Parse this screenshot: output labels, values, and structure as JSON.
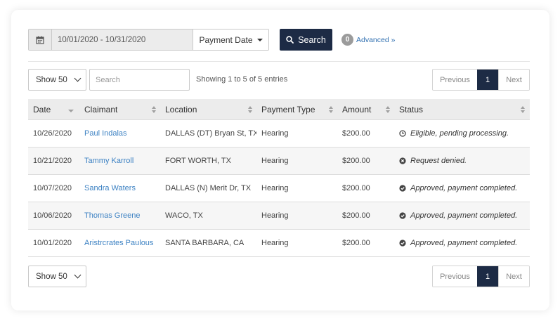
{
  "filter": {
    "calendar_icon": "calendar-icon",
    "date_range": "10/01/2020 - 10/31/2020",
    "date_type_label": "Payment Date",
    "search_label": "Search",
    "advanced_count": "0",
    "advanced_label": "Advanced »"
  },
  "controls": {
    "page_size": "Show 50",
    "search_placeholder": "Search",
    "info": "Showing 1 to 5 of 5 entries",
    "pager": {
      "previous": "Previous",
      "current": "1",
      "next": "Next"
    }
  },
  "table": {
    "columns": [
      "Date",
      "Claimant",
      "Location",
      "Payment Type",
      "Amount",
      "Status"
    ],
    "rows": [
      {
        "date": "10/26/2020",
        "claimant": "Paul Indalas",
        "location": "DALLAS (DT) Bryan St, TX",
        "type": "Hearing",
        "amount": "$200.00",
        "status": "Eligible, pending processing.",
        "status_icon": "clock-icon"
      },
      {
        "date": "10/21/2020",
        "claimant": "Tammy Karroll",
        "location": "FORT WORTH, TX",
        "type": "Hearing",
        "amount": "$200.00",
        "status": "Request denied.",
        "status_icon": "x-circle-icon"
      },
      {
        "date": "10/07/2020",
        "claimant": "Sandra Waters",
        "location": "DALLAS (N) Merit Dr, TX",
        "type": "Hearing",
        "amount": "$200.00",
        "status": "Approved, payment completed.",
        "status_icon": "check-circle-icon"
      },
      {
        "date": "10/06/2020",
        "claimant": "Thomas Greene",
        "location": "WACO, TX",
        "type": "Hearing",
        "amount": "$200.00",
        "status": "Approved, payment completed.",
        "status_icon": "check-circle-icon"
      },
      {
        "date": "10/01/2020",
        "claimant": "Aristrcrates Paulous",
        "location": "SANTA BARBARA, CA",
        "type": "Hearing",
        "amount": "$200.00",
        "status": "Approved, payment completed.",
        "status_icon": "check-circle-icon"
      }
    ]
  },
  "bottom": {
    "page_size": "Show 50",
    "pager": {
      "previous": "Previous",
      "current": "1",
      "next": "Next"
    }
  },
  "colors": {
    "primary_dark": "#1d2b45",
    "link": "#3d82c3",
    "header_bg": "#ececec"
  }
}
